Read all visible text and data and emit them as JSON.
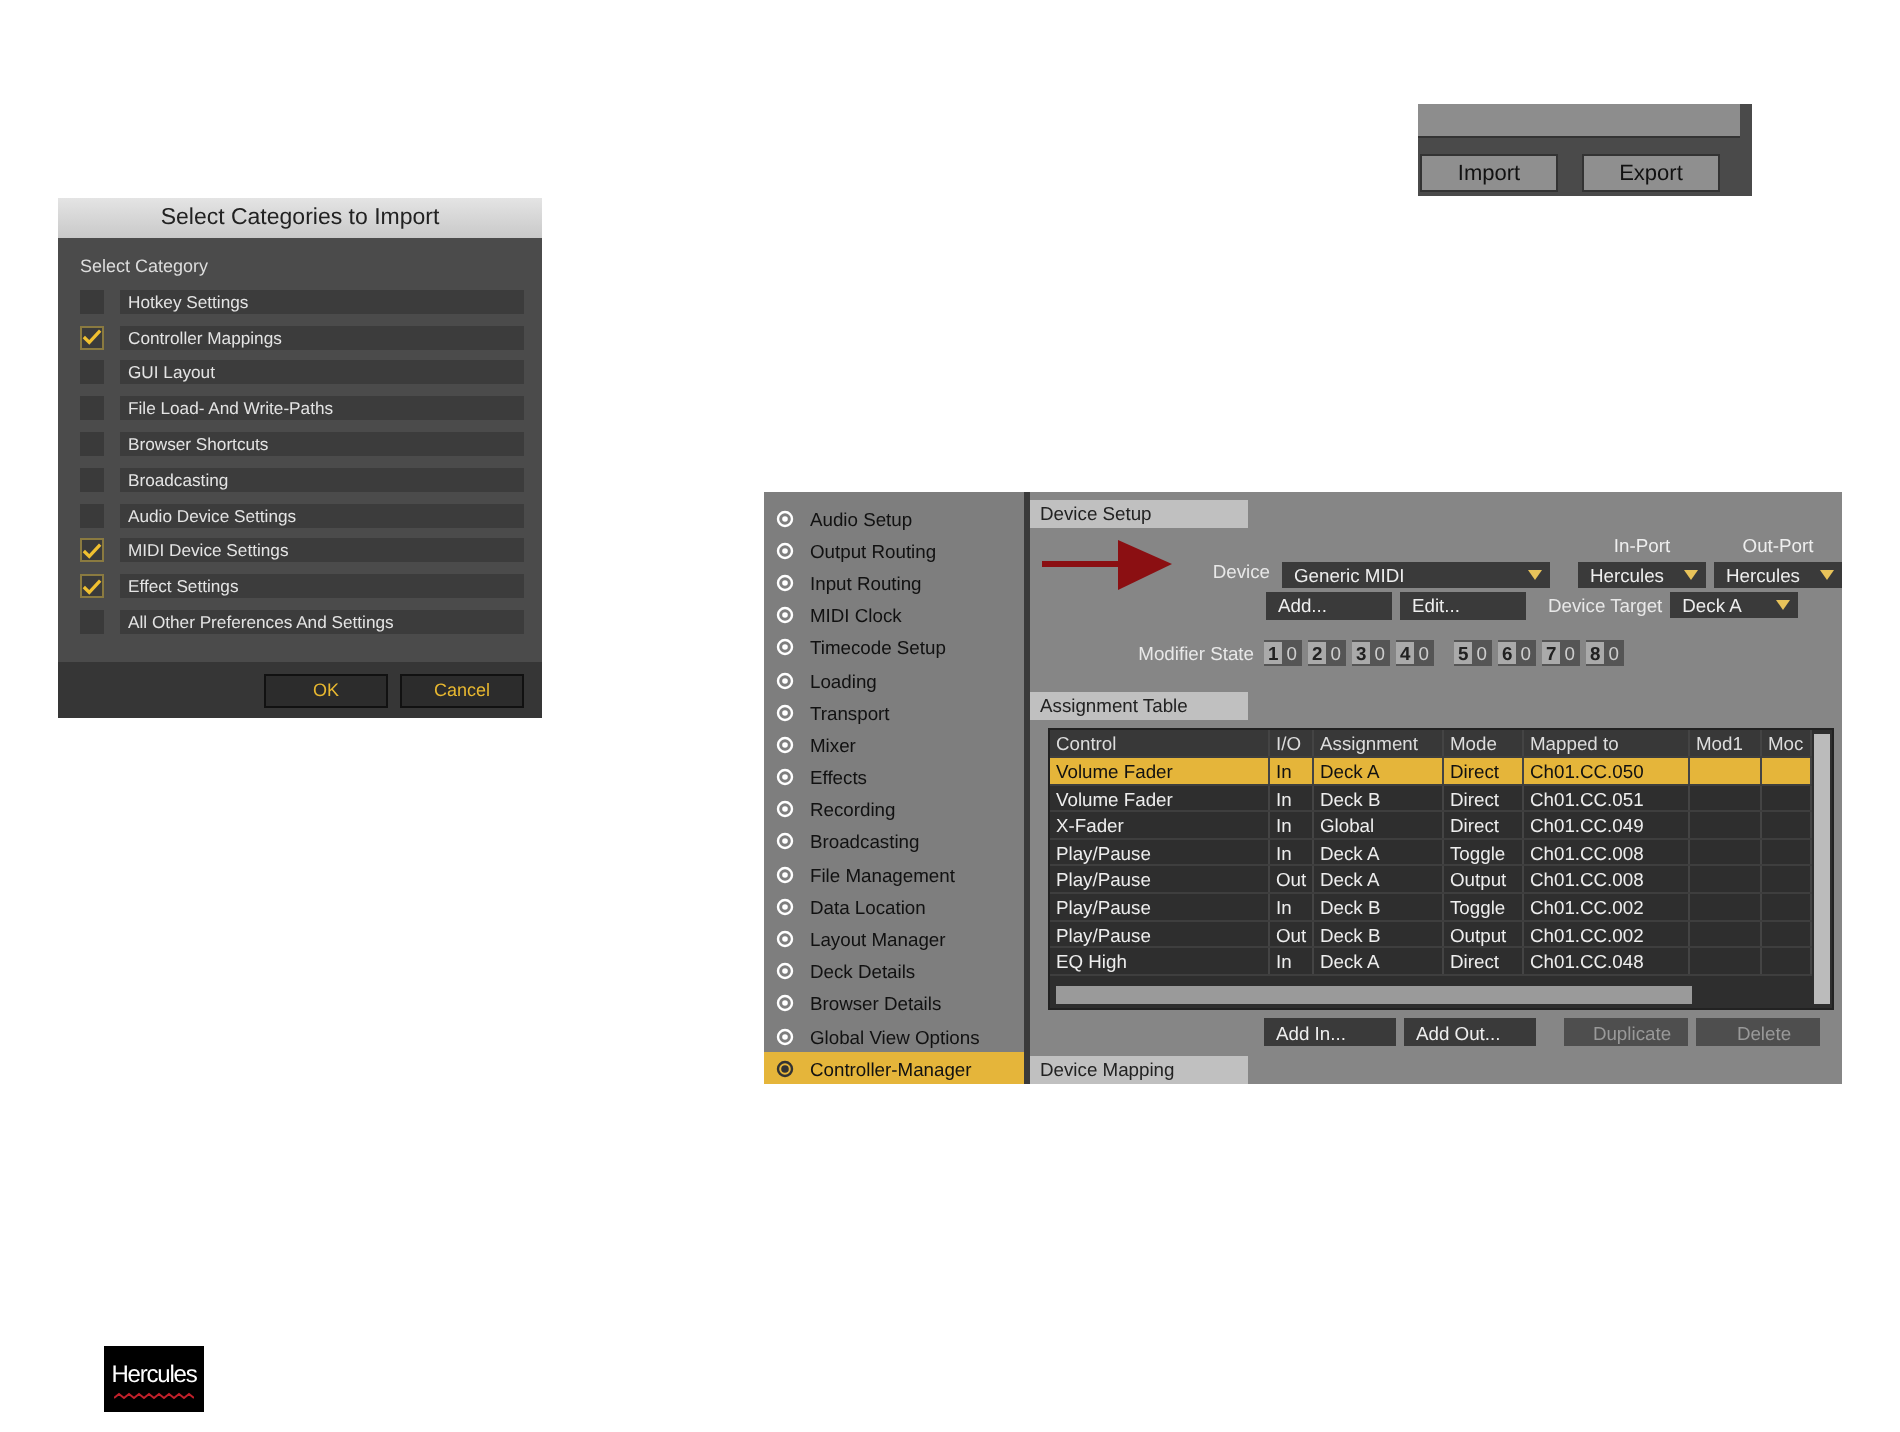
{
  "import_dialog": {
    "title": "Select Categories to Import",
    "section_label": "Select Category",
    "categories": [
      {
        "label": "Hotkey Settings",
        "checked": false
      },
      {
        "label": "Controller Mappings",
        "checked": true
      },
      {
        "label": "GUI Layout",
        "checked": false
      },
      {
        "label": "File Load- And Write-Paths",
        "checked": false
      },
      {
        "label": "Browser Shortcuts",
        "checked": false
      },
      {
        "label": "Broadcasting",
        "checked": false
      },
      {
        "label": "Audio Device Settings",
        "checked": false
      },
      {
        "label": "MIDI Device Settings",
        "checked": true
      },
      {
        "label": "Effect Settings",
        "checked": true
      },
      {
        "label": "All Other Preferences And Settings",
        "checked": false
      }
    ],
    "buttons": [
      "OK",
      "Cancel"
    ]
  },
  "import_export_panel": {
    "buttons": [
      "Import",
      "Export"
    ]
  },
  "preferences": {
    "sidebar": {
      "items": [
        {
          "label": "Audio Setup",
          "selected": false
        },
        {
          "label": "Output Routing",
          "selected": false
        },
        {
          "label": "Input Routing",
          "selected": false
        },
        {
          "label": "MIDI Clock",
          "selected": false
        },
        {
          "label": "Timecode Setup",
          "selected": false
        },
        {
          "label": "Loading",
          "selected": false
        },
        {
          "label": "Transport",
          "selected": false
        },
        {
          "label": "Mixer",
          "selected": false
        },
        {
          "label": "Effects",
          "selected": false
        },
        {
          "label": "Recording",
          "selected": false
        },
        {
          "label": "Broadcasting",
          "selected": false
        },
        {
          "label": "File Management",
          "selected": false
        },
        {
          "label": "Data Location",
          "selected": false
        },
        {
          "label": "Layout Manager",
          "selected": false
        },
        {
          "label": "Deck Details",
          "selected": false
        },
        {
          "label": "Browser Details",
          "selected": false
        },
        {
          "label": "Global View Options",
          "selected": false
        },
        {
          "label": "Controller-Manager",
          "selected": true
        }
      ]
    },
    "device_setup": {
      "title": "Device Setup",
      "device_label": "Device",
      "device_value": "Generic MIDI",
      "add_button": "Add...",
      "edit_button": "Edit...",
      "in_port_label": "In-Port",
      "in_port_value": "Hercules",
      "out_port_label": "Out-Port",
      "out_port_value": "Hercules",
      "device_target_label": "Device Target",
      "device_target_value": "Deck A",
      "modifier_state_label": "Modifier State",
      "modifiers": [
        {
          "number": "1",
          "value": "0"
        },
        {
          "number": "2",
          "value": "0"
        },
        {
          "number": "3",
          "value": "0"
        },
        {
          "number": "4",
          "value": "0"
        },
        {
          "number": "5",
          "value": "0"
        },
        {
          "number": "6",
          "value": "0"
        },
        {
          "number": "7",
          "value": "0"
        },
        {
          "number": "8",
          "value": "0"
        }
      ]
    },
    "assignment_table": {
      "title": "Assignment Table",
      "columns": [
        "Control",
        "I/O",
        "Assignment",
        "Mode",
        "Mapped to",
        "Mod1",
        "Moc"
      ],
      "rows": [
        {
          "cells": [
            "Volume Fader",
            "In",
            "Deck A",
            "Direct",
            "Ch01.CC.050"
          ],
          "selected": true
        },
        {
          "cells": [
            "Volume Fader",
            "In",
            "Deck B",
            "Direct",
            "Ch01.CC.051"
          ],
          "selected": false
        },
        {
          "cells": [
            "X-Fader",
            "In",
            "Global",
            "Direct",
            "Ch01.CC.049"
          ],
          "selected": false
        },
        {
          "cells": [
            "Play/Pause",
            "In",
            "Deck A",
            "Toggle",
            "Ch01.CC.008"
          ],
          "selected": false
        },
        {
          "cells": [
            "Play/Pause",
            "Out",
            "Deck A",
            "Output",
            "Ch01.CC.008"
          ],
          "selected": false
        },
        {
          "cells": [
            "Play/Pause",
            "In",
            "Deck B",
            "Toggle",
            "Ch01.CC.002"
          ],
          "selected": false
        },
        {
          "cells": [
            "Play/Pause",
            "Out",
            "Deck B",
            "Output",
            "Ch01.CC.002"
          ],
          "selected": false
        },
        {
          "cells": [
            "EQ High",
            "In",
            "Deck A",
            "Direct",
            "Ch01.CC.048"
          ],
          "selected": false
        }
      ],
      "buttons": [
        {
          "label": "Add In...",
          "disabled": false
        },
        {
          "label": "Add Out...",
          "disabled": false
        },
        {
          "label": "Duplicate",
          "disabled": true
        },
        {
          "label": "Delete",
          "disabled": true
        }
      ]
    },
    "device_mapping": {
      "title": "Device Mapping"
    }
  },
  "logo": {
    "text": "Hercules"
  }
}
